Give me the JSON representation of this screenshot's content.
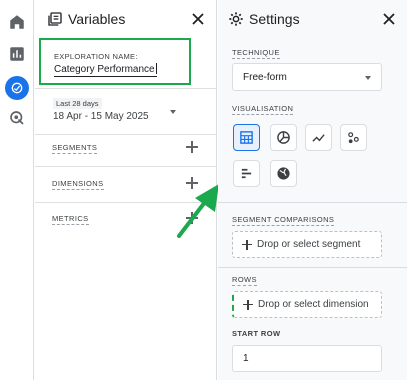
{
  "colors": {
    "accent": "#1a73e8",
    "highlight_box": "#1ca84e",
    "arrow": "#1ca84e"
  },
  "rail": {
    "items": [
      {
        "icon": "home-icon"
      },
      {
        "icon": "reports-icon"
      },
      {
        "icon": "explore-icon",
        "active": true
      },
      {
        "icon": "advertising-icon"
      }
    ]
  },
  "variables": {
    "title": "Variables",
    "exploration_name_label": "EXPLORATION NAME:",
    "exploration_name_value": "Category Performance",
    "date_preset": "Last 28 days",
    "date_range": "18 Apr - 15 May 2025",
    "segments_label": "SEGMENTS",
    "dimensions_label": "DIMENSIONS",
    "metrics_label": "METRICS"
  },
  "settings": {
    "title": "Settings",
    "technique_label": "TECHNIQUE",
    "technique_value": "Free-form",
    "visualisation_label": "VISUALISATION",
    "visualisations": [
      {
        "icon": "table-icon",
        "selected": true
      },
      {
        "icon": "donut-chart-icon",
        "selected": false
      },
      {
        "icon": "line-chart-icon",
        "selected": false
      },
      {
        "icon": "scatter-plot-icon",
        "selected": false
      },
      {
        "icon": "bar-chart-icon",
        "selected": false
      },
      {
        "icon": "geo-map-icon",
        "selected": false
      }
    ],
    "segment_comparisons_label": "SEGMENT COMPARISONS",
    "segment_drop_text": "Drop or select segment",
    "rows_label": "ROWS",
    "rows_drop_text": "Drop or select dimension",
    "start_row_label": "START ROW",
    "start_row_value": "1"
  }
}
